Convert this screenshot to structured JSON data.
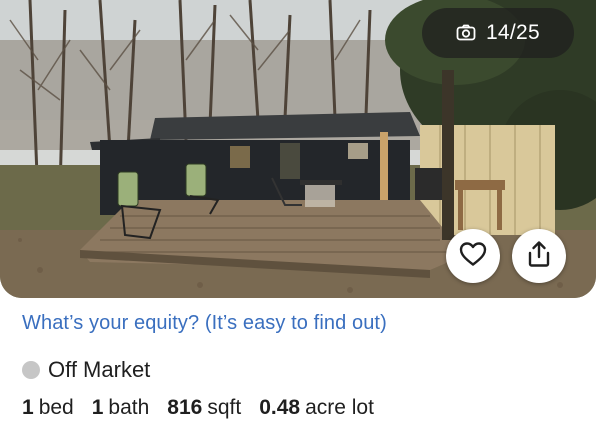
{
  "photo": {
    "counter_text": "14/25",
    "camera_icon": "camera-icon",
    "favorite_icon": "heart-icon",
    "share_icon": "share-icon"
  },
  "equity_link": "What’s your equity? (It’s easy to find out)",
  "status": {
    "label": "Off Market",
    "dot_color": "#c6c6c6"
  },
  "facts": [
    {
      "value": "1",
      "unit": "bed"
    },
    {
      "value": "1",
      "unit": "bath"
    },
    {
      "value": "816",
      "unit": "sqft"
    },
    {
      "value": "0.48",
      "unit": "acre lot"
    }
  ],
  "colors": {
    "link": "#3a6fbf",
    "text": "#1f1f1f"
  }
}
